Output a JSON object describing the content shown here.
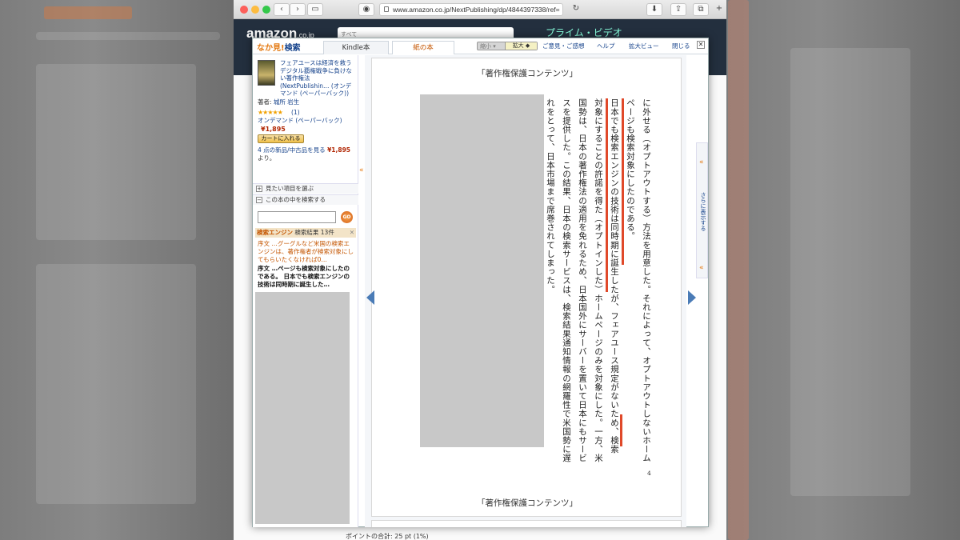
{
  "browser": {
    "url": "www.amazon.co.jp/NextPublishing/dp/4844397338/ref=",
    "back_label": "‹",
    "forward_label": "›",
    "sidebar_icon": "sidebar-icon",
    "reload_icon": "reload-icon",
    "add_tab_label": "+"
  },
  "amazon": {
    "logo": "amazon",
    "logo_suffix": ".co.jp",
    "search_placeholder": "すべて",
    "prime_text": "プライム・ビデオ",
    "bottom_points": "ポイントの合計: 25 pt (1%)"
  },
  "viewer_header": {
    "brand_a": "なか見!",
    "brand_b": "検索",
    "tab_kindle": "Kindle本",
    "tab_paper": "紙の本",
    "zoom_out": "縮小 ▾",
    "zoom_in": "拡大 ◆",
    "feedback": "ご意見・ご感想",
    "help": "ヘルプ",
    "expand": "拡大ビュー",
    "close_label": "閉じる"
  },
  "left_panel": {
    "book_title": "フェアユースは経済を救うデジタル覇権戦争に負けない著作権法 (NextPublishin… (オンデマンド (ペーパーバック))",
    "author_label": "著者:",
    "author_name": "城所 岩生",
    "stars": "★★★★★",
    "review_count": "(1)",
    "format": "オンデマンド (ペーパーバック)",
    "price": "¥1,895",
    "cart_button": "カートに入れる",
    "used_count": "4 点の新品/中古品を見る",
    "used_price": "¥1,895",
    "used_suffix": "より。",
    "row_see": "見たい項目を選ぶ",
    "row_search": "この本の中を検索する",
    "go_label": "GO",
    "results_term": "検索エンジン",
    "results_label": "検索結果",
    "results_count": "13件",
    "result1": "序文 …グーグルなど米国の検索エンジンは、著作権者が検索対象にしてもらいたくなければ0…",
    "result2": "序文 …ページも検索対象にしたのである。 日本でも検索エンジンの技術は同時期に誕生した…"
  },
  "page": {
    "header_notice": "「著作権保護コンテンツ」",
    "footer_notice": "「著作権保護コンテンツ」",
    "lines": [
      "に外せる（オプトアウトする）方法を用意した。それによって、オプトアウトしないホーム",
      "ページも検索対象にしたのである。",
      "日本でも検索エンジンの技術は同時期に誕生したが、フェアユース規定がないため、検索",
      "対象にすることの許諾を得た（オプトインした）ホームページのみを対象にした。一方、米",
      "国勢は、日本の著作権法の適用を免れるため、日本国外にサーバーを置いて日本にもサービ",
      "スを提供した。この結果、日本の検索サービスは、検索結果通知情報の網羅性で米国勢に遅",
      "れをとって、日本市場まで席巻されてしまった。"
    ],
    "page_number": "4"
  },
  "side_pane": {
    "more_label": "さらに表示する",
    "chevron": "«"
  }
}
